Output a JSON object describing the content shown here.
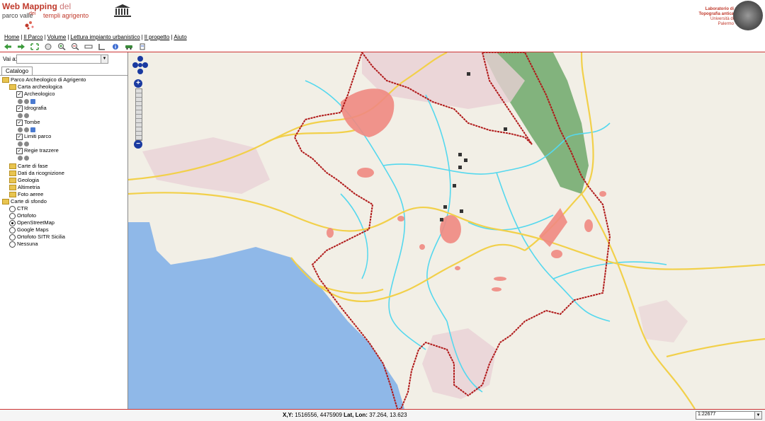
{
  "header": {
    "title_bold": "Web Mapping",
    "title_light": "del",
    "subtitle_pre": "parco valle",
    "subtitle_del": "dei",
    "subtitle_post": "templi agrigento",
    "lab_line1": "Laboratorio di",
    "lab_line2": "Topografia antica",
    "lab_line3": "Università di",
    "lab_line4": "Palermo"
  },
  "menu": [
    "Home",
    "Il Parco",
    "Volume",
    "Lettura impianto urbanistico",
    "Il progetto",
    "Aiuto"
  ],
  "toolbar": {
    "icons": [
      "back-icon",
      "forward-icon",
      "full-extent-icon",
      "pan-icon",
      "zoom-in-icon",
      "zoom-out-icon",
      "measure-line-icon",
      "measure-area-icon",
      "info-icon",
      "vehicle-icon",
      "print-icon"
    ]
  },
  "sidebar": {
    "vaia_label": "Vai a:",
    "vaia_value": "",
    "tab": "Catalogo",
    "tree": {
      "root": "Parco Archeologico di Agrigento",
      "carta": "Carta archeologica",
      "layers": [
        "Archeologico",
        "Idrografia",
        "Tombe",
        "Limiti parco",
        "Regie trazzere"
      ],
      "folders": [
        "Carte di fase",
        "Dati da ricognizione",
        "Geologia",
        "Altimetria",
        "Foto aeree"
      ],
      "sfondo": "Carte di sfondo",
      "basemaps": [
        "CTR",
        "Ortofoto",
        "OpenStreetMap",
        "Google Maps",
        "Ortofoto SITR Sicilia",
        "Nessuna"
      ],
      "selected_basemap": "OpenStreetMap"
    }
  },
  "status": {
    "xy_label": "X,Y:",
    "xy_value": "1516556, 4475909",
    "ll_label": "Lat, Lon:",
    "ll_value": "37.264, 13.623",
    "scale": "1:22677"
  },
  "colors": {
    "accent": "#c0392b",
    "sea": "#8fb8e8",
    "road": "#f2d04a",
    "river": "#55d8ee",
    "park_border": "#b01818",
    "archaeo": "#f08a82",
    "urban": "#e8cfd4",
    "forest": "#6fa86a"
  }
}
